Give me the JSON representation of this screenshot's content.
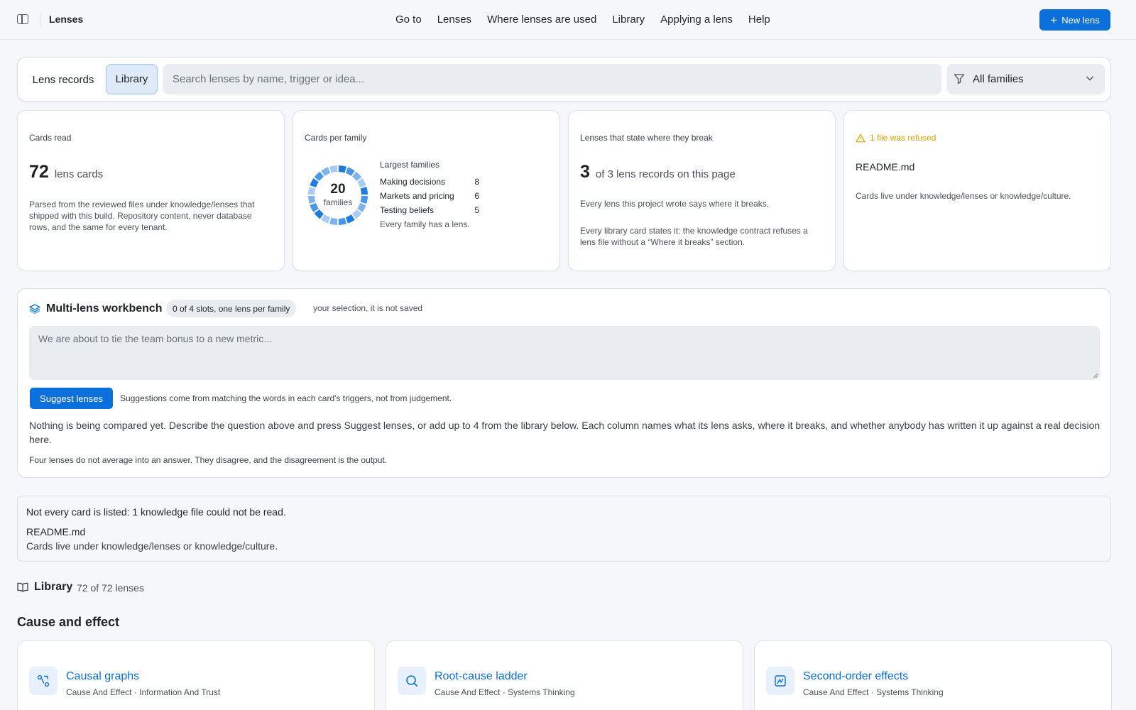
{
  "topbar": {
    "title": "Lenses",
    "nav": [
      "Go to",
      "Lenses",
      "Where lenses are used",
      "Library",
      "Applying a lens",
      "Help"
    ],
    "new_button": "New lens"
  },
  "search": {
    "tab_records": "Lens records",
    "tab_library": "Library",
    "placeholder": "Search lenses by name, trigger or idea...",
    "family_filter": "All families"
  },
  "stats": {
    "cards_read": {
      "label": "Cards read",
      "number": "72",
      "unit": "lens cards",
      "note": "Parsed from the reviewed files under knowledge/lenses that shipped with this build. Repository content, never database rows, and the same for every tenant."
    },
    "cards_per_family": {
      "label": "Cards per family",
      "center_number": "20",
      "center_label": "families",
      "largest_title": "Largest families",
      "families": [
        {
          "name": "Making decisions",
          "count": "8"
        },
        {
          "name": "Markets and pricing",
          "count": "6"
        },
        {
          "name": "Testing beliefs",
          "count": "5"
        }
      ],
      "footer": "Every family has a lens."
    },
    "break": {
      "label": "Lenses that state where they break",
      "number": "3",
      "unit": "of 3 lens records on this page",
      "note1": "Every lens this project wrote says where it breaks.",
      "note2": "Every library card states it: the knowledge contract refuses a lens file without a “Where it breaks” section."
    },
    "refused": {
      "label": "1 file was refused",
      "file": "README.md",
      "note": "Cards live under knowledge/lenses or knowledge/culture."
    }
  },
  "colors": {
    "accent": "#0b6fdc",
    "warning": "#d9a100",
    "donut_segments": [
      "#1f7be0",
      "#4a96e8",
      "#7fb4ef",
      "#a9ccf4"
    ]
  },
  "workbench": {
    "title": "Multi-lens workbench",
    "slots_pill": "0 of 4 slots, one lens per family",
    "note": "your selection, it is not saved",
    "placeholder": "We are about to tie the team bonus to a new metric...",
    "suggest_button": "Suggest lenses",
    "suggest_note": "Suggestions come from matching the words in each card's triggers, not from judgement.",
    "empty_text": "Nothing is being compared yet. Describe the question above and press Suggest lenses, or add up to 4 from the library below. Each column names what its lens asks, where it breaks, and whether anybody has written it up against a real decision here.",
    "footer": "Four lenses do not average into an answer. They disagree, and the disagreement is the output."
  },
  "notice": {
    "title": "Not every card is listed: 1 knowledge file could not be read.",
    "file": "README.md",
    "detail": "Cards live under knowledge/lenses or knowledge/culture."
  },
  "library": {
    "title": "Library",
    "count": "72 of 72 lenses",
    "group": "Cause and effect",
    "cards": [
      {
        "name": "Causal graphs",
        "meta": "Cause And Effect · Information And Trust",
        "icon": "causal-graph-icon"
      },
      {
        "name": "Root-cause ladder",
        "meta": "Cause And Effect · Systems Thinking",
        "icon": "search-icon"
      },
      {
        "name": "Second-order effects",
        "meta": "Cause And Effect · Systems Thinking",
        "icon": "chart-icon"
      }
    ]
  }
}
